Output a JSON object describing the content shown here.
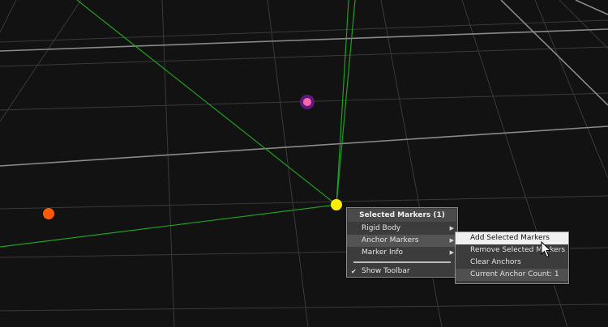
{
  "viewport": {
    "background": "#121212",
    "grid_color": "#3a3a3a",
    "axis_color": "#8a8a8a",
    "ray_color": "#1fa01f",
    "markers": [
      {
        "name": "selected-marker",
        "color": "#ffee00"
      },
      {
        "name": "orange-marker",
        "color": "#ff5a00"
      },
      {
        "name": "purple-marker",
        "color": "#ff66aa"
      }
    ]
  },
  "context_menu": {
    "header": "Selected Markers (1)",
    "items": [
      {
        "label": "Rigid Body",
        "has_submenu": true
      },
      {
        "label": "Anchor Markers",
        "has_submenu": true
      },
      {
        "label": "Marker Info",
        "has_submenu": true
      }
    ],
    "toolbar_toggle": {
      "label": "Show Toolbar",
      "checked": true,
      "check_glyph": "✔"
    }
  },
  "anchor_submenu": {
    "items": [
      {
        "label": "Add Selected Markers"
      },
      {
        "label": "Remove Selected Markers"
      },
      {
        "label": "Clear Anchors"
      }
    ],
    "info": "Current Anchor Count: 1"
  }
}
